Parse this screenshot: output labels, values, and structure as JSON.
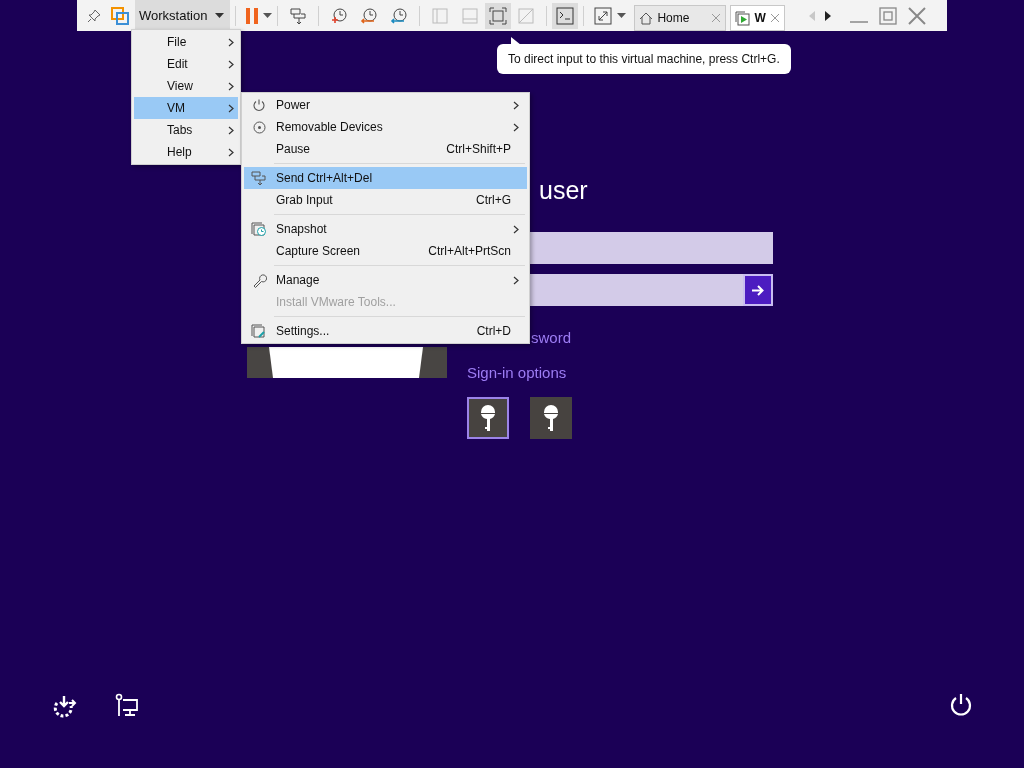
{
  "toolbar": {
    "menu_button": "Workstation",
    "menu_open": true,
    "tabs": [
      {
        "label": "Home",
        "selected": false
      },
      {
        "label": "W",
        "selected": true
      }
    ]
  },
  "workstation_menu": [
    {
      "label": "File",
      "selected": false
    },
    {
      "label": "Edit",
      "selected": false
    },
    {
      "label": "View",
      "selected": false
    },
    {
      "label": "VM",
      "selected": true
    },
    {
      "label": "Tabs",
      "selected": false
    },
    {
      "label": "Help",
      "selected": false
    }
  ],
  "vm_menu": [
    [
      {
        "label": "Power",
        "submenu": true,
        "disabled": false,
        "selected": false
      },
      {
        "label": "Removable Devices",
        "submenu": true,
        "disabled": false,
        "selected": false
      },
      {
        "label": "Pause",
        "shortcut": "Ctrl+Shift+P",
        "submenu": false,
        "disabled": false,
        "selected": false
      }
    ],
    [
      {
        "label": "Send Ctrl+Alt+Del",
        "submenu": false,
        "disabled": false,
        "selected": true
      },
      {
        "label": "Grab Input",
        "shortcut": "Ctrl+G",
        "submenu": false,
        "disabled": false,
        "selected": false
      }
    ],
    [
      {
        "label": "Snapshot",
        "submenu": true,
        "disabled": false,
        "selected": false
      },
      {
        "label": "Capture Screen",
        "shortcut": "Ctrl+Alt+PrtScn",
        "submenu": false,
        "disabled": false,
        "selected": false
      }
    ],
    [
      {
        "label": "Manage",
        "submenu": true,
        "disabled": false,
        "selected": false
      },
      {
        "label": "Install VMware Tools...",
        "submenu": false,
        "disabled": true,
        "selected": false
      }
    ],
    [
      {
        "label": "Settings...",
        "shortcut": "Ctrl+D",
        "submenu": false,
        "disabled": false,
        "selected": false
      }
    ]
  ],
  "tooltip": "To direct input to this virtual machine, press Ctrl+G.",
  "login": {
    "heading": "user",
    "link": "sword",
    "options_label": "Sign-in options",
    "tiles": [
      {
        "selected": true
      },
      {
        "selected": false
      }
    ]
  }
}
